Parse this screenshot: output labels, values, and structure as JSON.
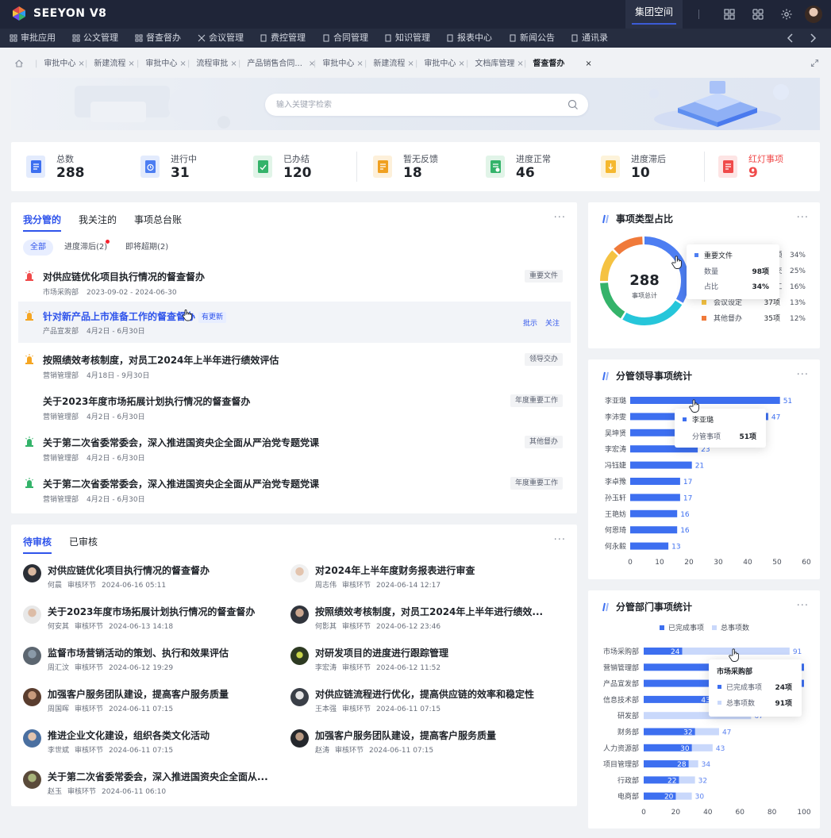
{
  "app": {
    "brand": "SEEYON V8",
    "space_label": "集团空间"
  },
  "nav": {
    "items": [
      "审批应用",
      "公文管理",
      "督查督办",
      "会议管理",
      "费控管理",
      "合同管理",
      "知识管理",
      "报表中心",
      "新闻公告",
      "通讯录"
    ]
  },
  "tabs": {
    "items": [
      "审批中心",
      "新建流程",
      "审批中心",
      "流程审批",
      "产品销售合同...",
      "审批中心",
      "新建流程",
      "审批中心",
      "文档库管理"
    ],
    "active": "督查督办"
  },
  "search": {
    "placeholder": "输入关键字检索"
  },
  "stats": [
    {
      "label": "总数",
      "value": "288",
      "color": "#3d6ff0"
    },
    {
      "label": "进行中",
      "value": "31",
      "color": "#4d7ef2"
    },
    {
      "label": "已办结",
      "value": "120",
      "color": "#34b36a"
    },
    {
      "label": "暂无反馈",
      "value": "18",
      "color": "#f0a020"
    },
    {
      "label": "进度正常",
      "value": "46",
      "color": "#34b36a"
    },
    {
      "label": "进度滞后",
      "value": "10",
      "color": "#f5b82e"
    },
    {
      "label": "红灯事项",
      "value": "9",
      "color": "#f04a4a"
    }
  ],
  "supervise": {
    "tabs": [
      "我分管的",
      "我关注的",
      "事项总台账"
    ],
    "more": "···",
    "filters": [
      "全部",
      "进度滞后(2)",
      "即将超期(2)"
    ],
    "actions": [
      "批示",
      "关注"
    ],
    "items": [
      {
        "title": "对供应链优化项目执行情况的督查督办",
        "dept": "市场采购部",
        "date": "2023-09-02 - 2024-06-30",
        "tag": "重要文件",
        "flag": "red",
        "badge": ""
      },
      {
        "title": "针对新产品上市准备工作的督查督办",
        "dept": "产品宣发部",
        "date": "4月2日 - 6月30日",
        "tag": "",
        "flag": "yellow",
        "badge": "有更新"
      },
      {
        "title": "按照绩效考核制度，对员工2024年上半年进行绩效评估",
        "dept": "营销管理部",
        "date": "4月18日 - 9月30日",
        "tag": "领导交办",
        "flag": "yellow",
        "badge": ""
      },
      {
        "title": "关于2023年度市场拓展计划执行情况的督查督办",
        "dept": "营销管理部",
        "date": "4月2日 - 6月30日",
        "tag": "年度重要工作",
        "flag": "none",
        "badge": ""
      },
      {
        "title": "关于第二次省委常委会，深入推进国资央企全面从严治党专题党课",
        "dept": "营销管理部",
        "date": "4月2日 - 6月30日",
        "tag": "其他督办",
        "flag": "green",
        "badge": ""
      },
      {
        "title": "关于第二次省委常委会，深入推进国资央企全面从严治党专题党课",
        "dept": "营销管理部",
        "date": "4月2日 - 6月30日",
        "tag": "年度重要工作",
        "flag": "green",
        "badge": ""
      }
    ]
  },
  "review": {
    "tabs": [
      "待审核",
      "已审核"
    ],
    "more": "···",
    "items": [
      {
        "title": "对供应链优化项目执行情况的督查督办",
        "person": "何晨",
        "stage": "审核环节",
        "time": "2024-06-16 05:11"
      },
      {
        "title": "对2024年上半年度财务报表进行审查",
        "person": "周志伟",
        "stage": "审核环节",
        "time": "2024-06-14 12:17"
      },
      {
        "title": "关于2023年度市场拓展计划执行情况的督查督办",
        "person": "何安其",
        "stage": "审核环节",
        "time": "2024-06-13 14:18"
      },
      {
        "title": "按照绩效考核制度，对员工2024年上半年进行绩效...",
        "person": "何影其",
        "stage": "审核环节",
        "time": "2024-06-12 23:46"
      },
      {
        "title": "监督市场营销活动的策划、执行和效果评估",
        "person": "周汇汶",
        "stage": "审核环节",
        "time": "2024-06-12 19:29"
      },
      {
        "title": "对研发项目的进度进行跟踪管理",
        "person": "李宏涛",
        "stage": "审核环节",
        "time": "2024-06-12 11:52"
      },
      {
        "title": "加强客户服务团队建设，提高客户服务质量",
        "person": "周国晖",
        "stage": "审核环节",
        "time": "2024-06-11 07:15"
      },
      {
        "title": "对供应链流程进行优化，提高供应链的效率和稳定性",
        "person": "王本强",
        "stage": "审核环节",
        "time": "2024-06-11 07:15"
      },
      {
        "title": "推进企业文化建设，组织各类文化活动",
        "person": "李世斌",
        "stage": "审核环节",
        "time": "2024-06-11 07:15"
      },
      {
        "title": "加强客户服务团队建设，提高客户服务质量",
        "person": "赵涛",
        "stage": "审核环节",
        "time": "2024-06-11 07:15"
      },
      {
        "title": "关于第二次省委常委会，深入推进国资央企全面从...",
        "person": "赵玉",
        "stage": "审核环节",
        "time": "2024-06-11 06:10"
      }
    ]
  },
  "chart_data": [
    {
      "type": "pie",
      "title": "事项类型占比",
      "center_value": "288",
      "center_label": "事项总计",
      "categories": [
        "重要文件",
        "领导交办",
        "年度重要工作",
        "会议设定",
        "其他督办"
      ],
      "values": [
        98,
        72,
        46,
        37,
        35
      ],
      "percents": [
        "34%",
        "25%",
        "16%",
        "13%",
        "12%"
      ],
      "colors": [
        "#4d7ef2",
        "#26c6da",
        "#34b36a",
        "#f5c242",
        "#f07a3a"
      ],
      "tooltip": {
        "name": "重要文件",
        "count_label": "数量",
        "count": "98项",
        "share_label": "占比",
        "share": "34%"
      },
      "visible_rows": [
        {
          "name": "会议设定",
          "count": "37项",
          "pct": "13%"
        },
        {
          "name": "其他督办",
          "count": "35项",
          "pct": "12%"
        }
      ]
    },
    {
      "type": "bar",
      "title": "分管领导事项统计",
      "categories": [
        "李亚璐",
        "李沛雯",
        "吴坤贤",
        "李宏涛",
        "冯钰婕",
        "李卓豫",
        "孙玉轩",
        "王艳妨",
        "何恩琦",
        "何永毅"
      ],
      "values": [
        51,
        47,
        24,
        23,
        21,
        17,
        17,
        16,
        16,
        13
      ],
      "xlim": [
        0,
        60
      ],
      "xticks": [
        "0",
        "10",
        "20",
        "30",
        "40",
        "50",
        "60"
      ],
      "color": "#3d6ff0",
      "tooltip": {
        "name": "李亚璐",
        "label": "分管事项",
        "value": "51项"
      }
    },
    {
      "type": "bar",
      "title": "分管部门事项统计",
      "legend": [
        "已完成事项",
        "总事项数"
      ],
      "categories": [
        "市场采购部",
        "营销管理部",
        "产品宣发部",
        "信息技术部",
        "研发部",
        "财务部",
        "人力资源部",
        "项目管理部",
        "行政部",
        "电商部"
      ],
      "series": [
        {
          "name": "已完成事项",
          "values": [
            24,
            0,
            0,
            43,
            0,
            32,
            30,
            28,
            22,
            20
          ],
          "color": "#3d6ff0"
        },
        {
          "name": "总事项数",
          "values": [
            91,
            0,
            0,
            0,
            67,
            47,
            43,
            34,
            32,
            30
          ],
          "color": "#c9d8fb"
        }
      ],
      "xlim": [
        0,
        100
      ],
      "xticks": [
        "0",
        "20",
        "40",
        "60",
        "80",
        "100"
      ],
      "tooltip": {
        "name": "市场采购部",
        "rows": [
          {
            "label": "已完成事项",
            "value": "24项"
          },
          {
            "label": "总事项数",
            "value": "91项"
          }
        ]
      }
    }
  ]
}
